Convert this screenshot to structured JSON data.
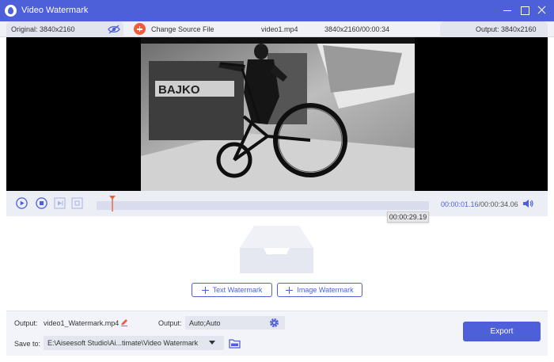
{
  "window": {
    "title": "Video Watermark",
    "controls": [
      "minimize",
      "maximize",
      "close"
    ]
  },
  "infobar": {
    "original_label": "Original: 3840x2160",
    "change_source_label": "Change Source File",
    "file_name": "video1.mp4",
    "resolution_duration": "3840x2160/00:00:34",
    "output_label": "Output: 3840x2160"
  },
  "player": {
    "current_time": "00:00:01.16",
    "total_time": "/00:00:34.06",
    "hover_time": "00:00:29.19",
    "progress_fraction": 0.047
  },
  "watermark": {
    "text_button": "Text Watermark",
    "image_button": "Image Watermark"
  },
  "footer": {
    "output_label": "Output:",
    "output_file": "video1_Watermark.mp4",
    "format_label": "Output:",
    "format_value": "Auto;Auto",
    "save_to_label": "Save to:",
    "save_to_path": "E:\\Aiseesoft Studio\\Ai...timate\\Video Watermark",
    "export_label": "Export"
  },
  "colors": {
    "accent": "#4d5fd9",
    "add": "#f05d3b",
    "playhead": "#f05d3b"
  },
  "icons": [
    "app-logo-icon",
    "eye-icon",
    "add-icon",
    "play-icon",
    "stop-icon",
    "prev-frame-icon",
    "next-frame-icon",
    "volume-icon",
    "empty-tray-icon",
    "edit-icon",
    "gear-icon",
    "chevron-down-icon",
    "folder-icon"
  ]
}
